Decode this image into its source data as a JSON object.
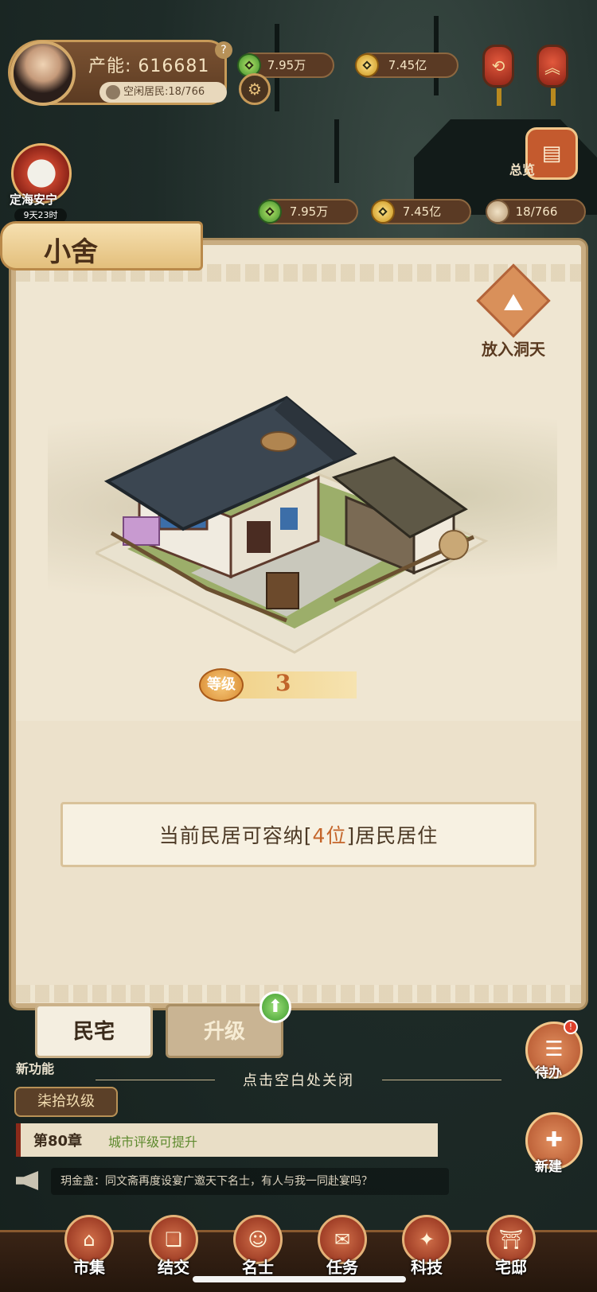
{
  "hud": {
    "capacity_text": "产能: 616681",
    "idle_residents": "空闲居民:18/766",
    "copper_top": "7.95万",
    "gold_top": "7.45亿",
    "overview_label": "总览",
    "event_name": "定海安宁",
    "event_timer": "9天23时"
  },
  "dialog": {
    "title": "小舍",
    "resources": {
      "copper": "7.95万",
      "gold": "7.45亿",
      "residents": "18/766"
    },
    "cave_button": "放入洞天",
    "level_label": "等级",
    "level_value": "3",
    "capacity_prefix": "当前民居可容纳[",
    "capacity_highlight": "4位",
    "capacity_suffix": "]居民居住",
    "tabs": {
      "home": "民宅",
      "upgrade": "升级"
    },
    "close_hint": "点击空白处关闭"
  },
  "lower_hud": {
    "new_feature": "新功能",
    "level_chip": "柒拾玖级",
    "chapter": "第80章",
    "chapter_hint": "城市评级可提升",
    "chat_message": "玥金盏：同文斋再度设宴广邀天下名士，有人与我一同赴宴吗？",
    "todo_label": "待办",
    "todo_badge": "!",
    "build_label": "新建"
  },
  "nav": {
    "items": [
      {
        "label": "市集",
        "icon": "market-icon"
      },
      {
        "label": "结交",
        "icon": "cards-icon"
      },
      {
        "label": "名士",
        "icon": "scholar-icon"
      },
      {
        "label": "任务",
        "icon": "scroll-icon"
      },
      {
        "label": "科技",
        "icon": "tech-icon"
      },
      {
        "label": "宅邸",
        "icon": "mansion-icon"
      }
    ]
  },
  "colors": {
    "accent_orange": "#c4652a",
    "paper": "#efe6d2",
    "hud_brown": "#5a3a24",
    "upgrade_green": "#3c9a2c"
  }
}
